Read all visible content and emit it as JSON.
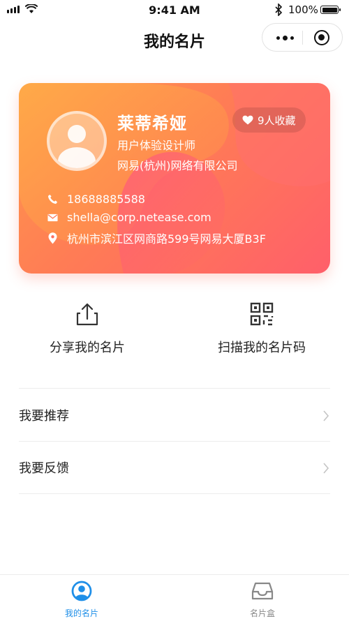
{
  "status_bar": {
    "time": "9:41 AM",
    "battery": "100%",
    "icons": [
      "signal-icon",
      "wifi-icon",
      "bluetooth-icon",
      "battery-icon"
    ]
  },
  "nav": {
    "title": "我的名片",
    "capsule_icons": [
      "more-icon",
      "close-miniprogram-icon"
    ]
  },
  "card": {
    "name": "莱蒂希娅",
    "job_title": "用户体验设计师",
    "company": "网易(杭州)网络有限公司",
    "favorites": "9人收藏",
    "phone": "18688885588",
    "email": "shella@corp.netease.com",
    "address": "杭州市滨江区网商路599号网易大厦B3F",
    "gradient_colors": [
      "#ff9a4a",
      "#ff7c55",
      "#ff5f6a",
      "#ff3f7a"
    ]
  },
  "actions": [
    {
      "label": "分享我的名片",
      "icon": "share-icon"
    },
    {
      "label": "扫描我的名片码",
      "icon": "qr-code-icon"
    }
  ],
  "menu": [
    {
      "label": "我要推荐"
    },
    {
      "label": "我要反馈"
    }
  ],
  "tabs": [
    {
      "label": "我的名片",
      "icon": "user-circle-icon",
      "active": true,
      "color": "#1f8fe8"
    },
    {
      "label": "名片盒",
      "icon": "inbox-tray-icon",
      "active": false,
      "color": "#888888"
    }
  ]
}
